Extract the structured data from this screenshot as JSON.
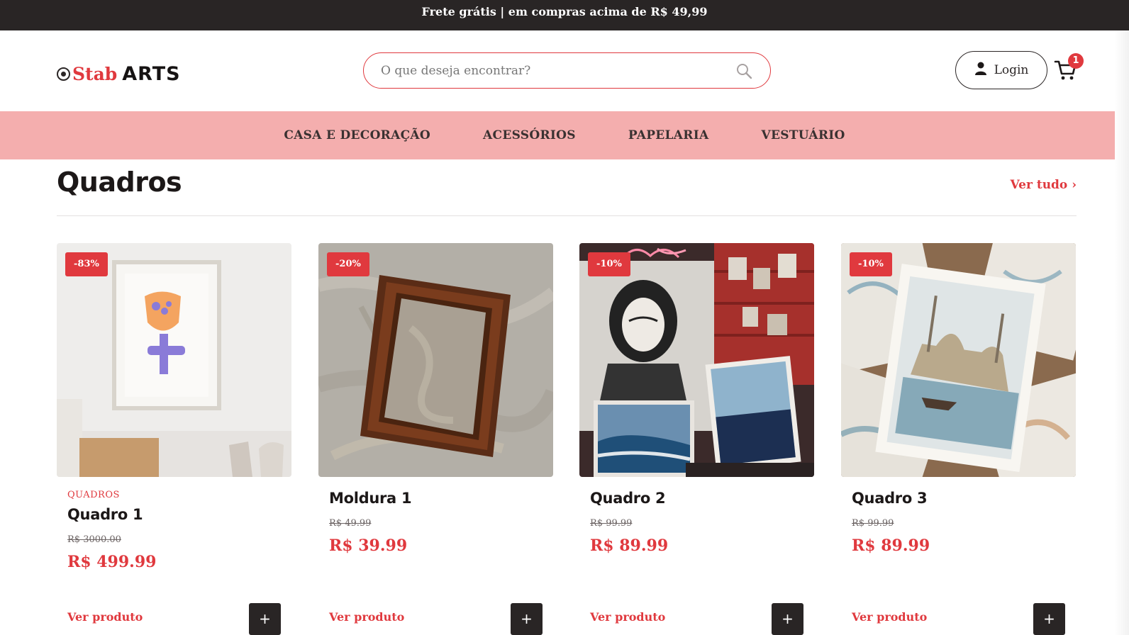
{
  "promo_bar": {
    "text": "Frete grátis | em compras acima de R$ 49,99"
  },
  "header": {
    "logo_left": "Stab",
    "logo_right": "ARTS",
    "search_placeholder": "O que deseja encontrar?",
    "login_label": "Login",
    "cart_count": "1"
  },
  "nav": {
    "items": [
      {
        "label": "CASA E DECORAÇÃO"
      },
      {
        "label": "ACESSÓRIOS"
      },
      {
        "label": "PAPELARIA"
      },
      {
        "label": "VESTUÁRIO"
      }
    ]
  },
  "section": {
    "title": "Quadros",
    "see_all": "Ver tudo ›"
  },
  "products": [
    {
      "badge": "-83%",
      "category": "QUADROS",
      "name": "Quadro 1",
      "old_price": "R$ 3000.00",
      "price": "R$ 499.99",
      "view_label": "Ver produto",
      "add_label": "+",
      "image_icon": "framed-flower-art"
    },
    {
      "badge": "-20%",
      "category": "",
      "name": "Moldura 1",
      "old_price": "R$ 49.99",
      "price": "R$ 39.99",
      "view_label": "Ver produto",
      "add_label": "+",
      "image_icon": "wooden-frame"
    },
    {
      "badge": "-10%",
      "category": "",
      "name": "Quadro 2",
      "old_price": "R$ 99.99",
      "price": "R$ 89.99",
      "view_label": "Ver produto",
      "add_label": "+",
      "image_icon": "art-studio-wall"
    },
    {
      "badge": "-10%",
      "category": "",
      "name": "Quadro 3",
      "old_price": "R$ 99.99",
      "price": "R$ 89.99",
      "view_label": "Ver produto",
      "add_label": "+",
      "image_icon": "mosque-watercolor-prints"
    }
  ],
  "colors": {
    "accent": "#e0393e",
    "dark": "#292525",
    "nav_bg": "#f4aeae"
  }
}
